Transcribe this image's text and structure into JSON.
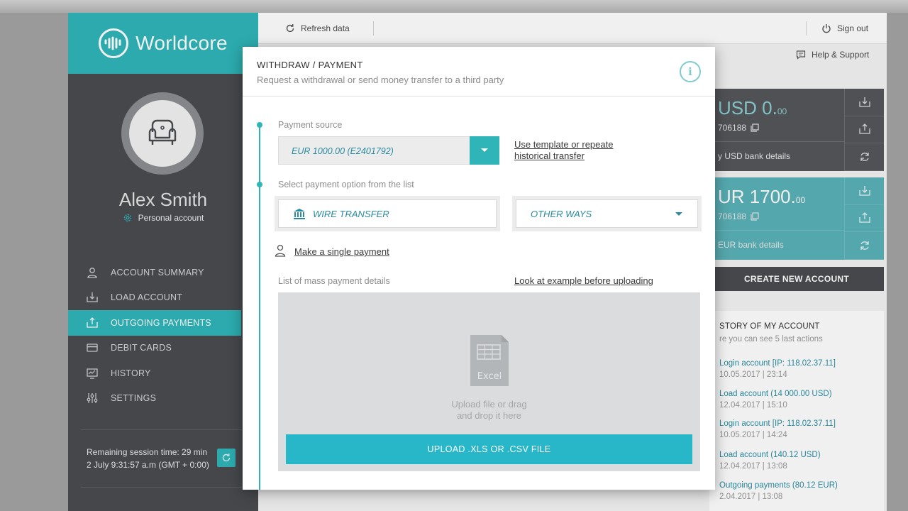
{
  "brand": {
    "name": "Worldcore",
    "accent": "#2fb5b8"
  },
  "user": {
    "name": "Alex Smith",
    "account_type": "Personal account"
  },
  "nav": [
    {
      "label": "ACCOUNT SUMMARY",
      "icon": "user-icon"
    },
    {
      "label": "LOAD ACCOUNT",
      "icon": "download-tray-icon"
    },
    {
      "label": "OUTGOING PAYMENTS",
      "icon": "upload-tray-icon"
    },
    {
      "label": "DEBIT CARDS",
      "icon": "card-icon"
    },
    {
      "label": "HISTORY",
      "icon": "chart-monitor-icon"
    },
    {
      "label": "SETTINGS",
      "icon": "sliders-icon"
    }
  ],
  "session": {
    "remaining": "Remaining session time: 29 min",
    "clock": "2 July 9:31:57 a.m (GMT + 0:00)"
  },
  "topbar": {
    "refresh": "Refresh data",
    "signout": "Sign out",
    "help": "Help & Support"
  },
  "accounts": [
    {
      "amount_main": "USD 0.",
      "amount_cents": "00",
      "number": "706188",
      "bank": "y USD bank details"
    },
    {
      "amount_main": "UR 1700.",
      "amount_cents": "00",
      "number": "706188",
      "bank": "EUR bank details"
    }
  ],
  "create_account": "CREATE NEW ACCOUNT",
  "history": {
    "title": "STORY OF MY ACCOUNT",
    "subtitle": "re you can see 5 last actions",
    "items": [
      {
        "action": "Login account [IP: 118.02.37.11]",
        "date": "10.05.2017 | 23:14"
      },
      {
        "action": "Load account (14 000.00 USD)",
        "date": "12.04.2017 | 15:10"
      },
      {
        "action": "Login account [IP: 118.02.37.11]",
        "date": "10.05.2017 | 14:24"
      },
      {
        "action": "Load account (140.12 USD)",
        "date": "12.04.2017 | 13:08"
      },
      {
        "action": "Outgoing payments (80.12 EUR)",
        "date": "2.04.2017 | 13:08"
      }
    ]
  },
  "modal": {
    "title": "WITHDRAW / PAYMENT",
    "subtitle": "Request a withdrawal or send money transfer to a third party",
    "payment_source_label": "Payment source",
    "payment_source_value": "EUR 1000.00 (E2401792)",
    "template_link_1": "Use template or repeate",
    "template_link_2": "historical transfer",
    "option_label": "Select payment option from the list",
    "wire_transfer": "WIRE TRANSFER",
    "other_ways": "OTHER WAYS",
    "single_payment": "Make a single payment",
    "mass_label": "List of mass payment details",
    "example_link": "Look at example before uploading",
    "excel_label": "Excel",
    "drop_line_1": "Upload file or drag",
    "drop_line_2": "and drop it here",
    "upload_button": "UPLOAD .XLS OR .CSV FILE"
  }
}
